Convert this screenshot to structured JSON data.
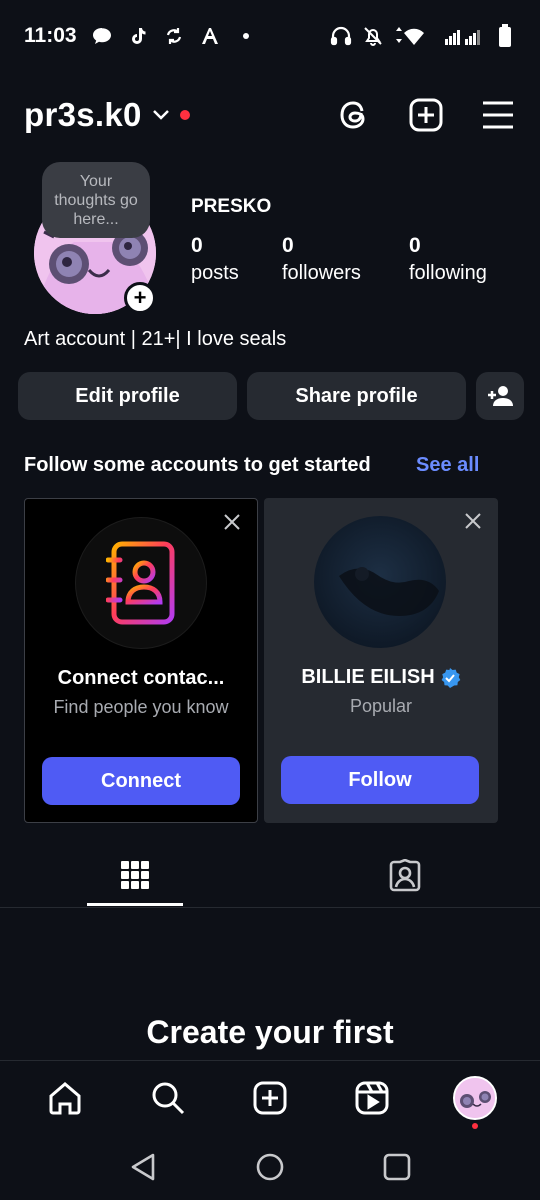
{
  "status_bar": {
    "time": "11:03",
    "icons": [
      "chat-bubble-icon",
      "tiktok-icon",
      "sync-icon",
      "font-a-icon",
      "dot-icon",
      "headphones-icon",
      "bell-off-icon",
      "wifi-icon",
      "signal-icon",
      "battery-icon"
    ]
  },
  "header": {
    "username": "pr3s.k0",
    "icons": [
      "chevron-down-icon",
      "threads-icon",
      "create-post-icon",
      "menu-icon"
    ],
    "notification_color": "#ff3040"
  },
  "profile": {
    "thought_placeholder": "Your thoughts go here...",
    "display_name": "PRESKO",
    "stats": [
      {
        "num": "0",
        "label": "posts"
      },
      {
        "num": "0",
        "label": "followers"
      },
      {
        "num": "0",
        "label": "following"
      }
    ],
    "bio": "Art account | 21+| I love seals"
  },
  "actions": {
    "edit_label": "Edit profile",
    "share_label": "Share profile",
    "add_user_icon": "add-person-icon"
  },
  "suggestions": {
    "title": "Follow some accounts to get started",
    "see_all": "See all",
    "cards": [
      {
        "name": "Connect contac...",
        "subtitle": "Find people you know",
        "button": "Connect",
        "icon": "contacts-book-icon"
      },
      {
        "name": "BILLIE EILISH",
        "subtitle": "Popular",
        "button": "Follow",
        "verified": true
      }
    ]
  },
  "tabs": {
    "items": [
      "grid-icon",
      "tagged-icon"
    ]
  },
  "empty_state": {
    "title": "Create your first"
  },
  "bottom_nav": {
    "items": [
      "home-icon",
      "search-icon",
      "create-icon",
      "reels-icon",
      "profile-avatar"
    ]
  },
  "colors": {
    "background": "#0d1017",
    "button_gray": "#262a31",
    "accent_blue": "#4f5bf4",
    "link_blue": "#6b8cff",
    "verified_blue": "#3897f0"
  }
}
